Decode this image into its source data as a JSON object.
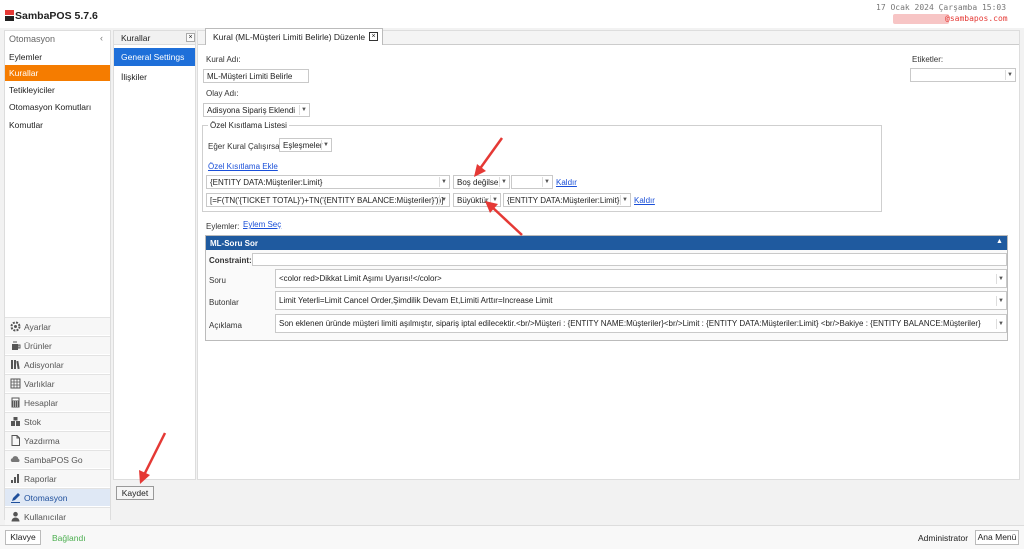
{
  "app": {
    "title": "SambaPOS 5.7.6",
    "datetime": "17 Ocak 2024 Çarşamba 15:03",
    "email": "@sambapos.com"
  },
  "nav": {
    "header": "Otomasyon",
    "collapse_icon": "‹",
    "items": [
      {
        "label": "Eylemler"
      },
      {
        "label": "Kurallar"
      },
      {
        "label": "Tetikleyiciler"
      },
      {
        "label": "Otomasyon Komutları"
      },
      {
        "label": "Komutlar"
      }
    ],
    "active_index": 1
  },
  "modules": [
    {
      "label": "Ayarlar",
      "icon": "gear-icon"
    },
    {
      "label": "Ürünler",
      "icon": "coffee-icon"
    },
    {
      "label": "Adisyonlar",
      "icon": "books-icon"
    },
    {
      "label": "Varlıklar",
      "icon": "grid-icon"
    },
    {
      "label": "Hesaplar",
      "icon": "calculator-icon"
    },
    {
      "label": "Stok",
      "icon": "boxes-icon"
    },
    {
      "label": "Yazdırma",
      "icon": "document-icon"
    },
    {
      "label": "SambaPOS Go",
      "icon": "cloud-icon"
    },
    {
      "label": "Raporlar",
      "icon": "bar-chart-icon"
    },
    {
      "label": "Otomasyon",
      "icon": "pencil-icon"
    },
    {
      "label": "Kullanıcılar",
      "icon": "user-icon"
    }
  ],
  "col2": {
    "tab_label": "Kurallar",
    "close": "×",
    "general": "General Settings",
    "relations": "İlişkiler"
  },
  "editor": {
    "tab_label": "Kural (ML-Müşteri Limiti Belirle) Düzenle",
    "tab_close": "×",
    "rule_name_label": "Kural Adı:",
    "rule_name_value": "ML-Müşteri Limiti Belirle",
    "event_label": "Olay Adı:",
    "event_value": "Adisyona Sipariş Eklendi",
    "tags_label": "Etiketler:",
    "tags_value": "",
    "constraints": {
      "title": "Özel Kısıtlama Listesi",
      "run_if_label": "Eğer Kural Çalışırsa",
      "run_if_value": "Eşleşmeler",
      "add_link": "Özel Kısıtlama Ekle",
      "rows": [
        {
          "left": "{ENTITY DATA:Müşteriler:Limit}",
          "op": "Boş değilse",
          "right": "",
          "remove": "Kaldır"
        },
        {
          "left": "[=F(TN('{TICKET TOTAL}')+TN('{ENTITY BALANCE:Müşteriler}'))]",
          "op": "Büyüktür",
          "right": "{ENTITY DATA:Müşteriler:Limit}",
          "remove": "Kaldır"
        }
      ]
    },
    "actions_label": "Eylemler:",
    "select_action_link": "Eylem Seç",
    "action": {
      "title": "ML-Soru Sor",
      "collapse": "▲",
      "constraint_label": "Constraint:",
      "constraint_value": "",
      "question_label": "Soru",
      "question_value": "<color red>Dikkat Limit Aşımı Uyarısı!</color>",
      "buttons_label": "Butonlar",
      "buttons_value": "Limit Yeterli=Limit Cancel Order,Şimdilik Devam Et,Limiti Arttır=Increase Limit",
      "desc_label": "Açıklama",
      "desc_value": "Son eklenen üründe müşteri limiti aşılmıştır, sipariş iptal edilecektir.<br/>Müşteri : {ENTITY NAME:Müşteriler}<br/>Limit : {ENTITY DATA:Müşteriler:Limit} <br/>Bakiye : {ENTITY BALANCE:Müşteriler}"
    },
    "save": "Kaydet"
  },
  "status": {
    "keyboard": "Klavye",
    "connection": "Bağlandı",
    "user": "Administrator",
    "main_menu": "Ana Menü"
  },
  "colors": {
    "accent_orange": "#f57c00",
    "accent_blue": "#1e6fd9",
    "header_blue": "#1f5a9f",
    "annotation_red": "#e53935"
  }
}
